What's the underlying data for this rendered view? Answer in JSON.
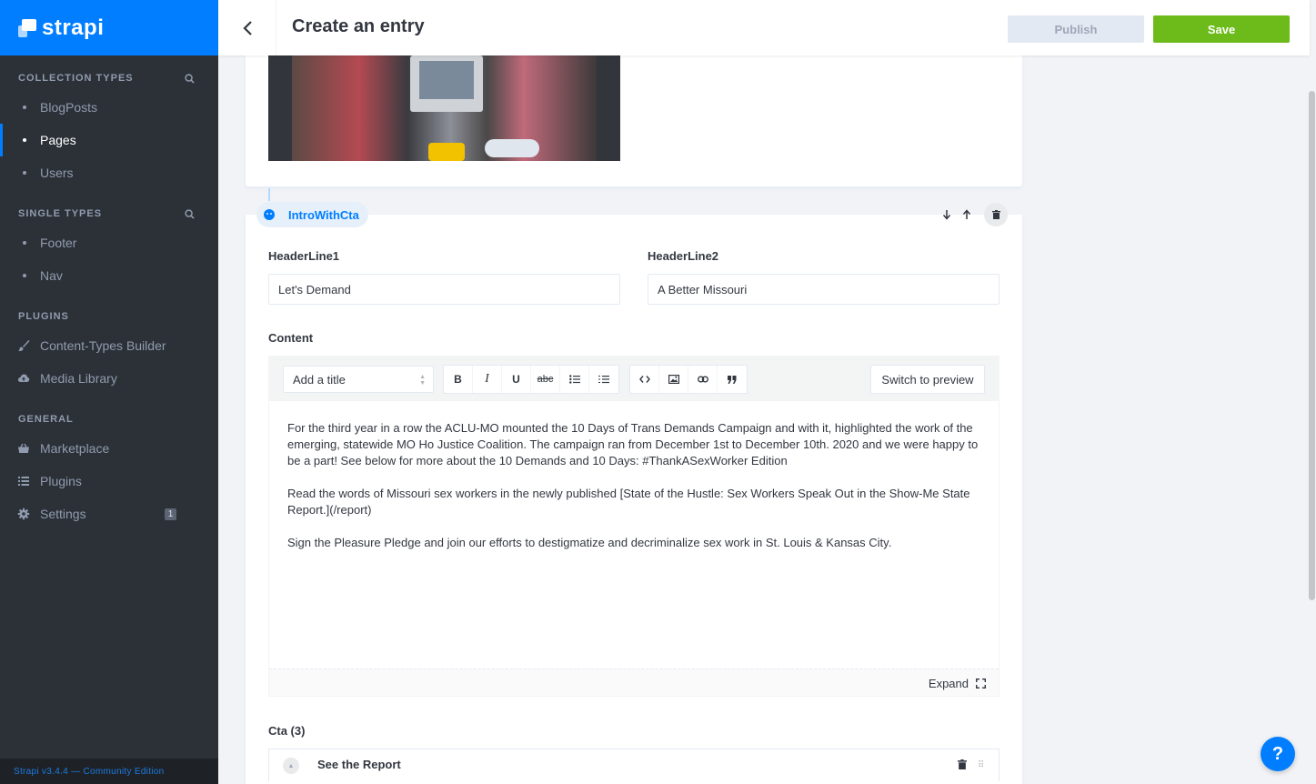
{
  "brand": {
    "name": "strapi"
  },
  "sidebar": {
    "collection_types": {
      "title": "COLLECTION TYPES",
      "items": [
        {
          "label": "BlogPosts"
        },
        {
          "label": "Pages"
        },
        {
          "label": "Users"
        }
      ]
    },
    "single_types": {
      "title": "SINGLE TYPES",
      "items": [
        {
          "label": "Footer"
        },
        {
          "label": "Nav"
        }
      ]
    },
    "plugins": {
      "title": "PLUGINS",
      "items": [
        {
          "label": "Content-Types Builder",
          "icon": "brush-icon"
        },
        {
          "label": "Media Library",
          "icon": "cloud-upload-icon"
        }
      ]
    },
    "general": {
      "title": "GENERAL",
      "items": [
        {
          "label": "Marketplace",
          "icon": "basket-icon"
        },
        {
          "label": "Plugins",
          "icon": "list-icon"
        },
        {
          "label": "Settings",
          "icon": "gear-icon",
          "badge": "1"
        }
      ]
    },
    "version": "Strapi v3.4.4 — Community Edition"
  },
  "header": {
    "title": "Create an entry",
    "publish_label": "Publish",
    "save_label": "Save"
  },
  "component": {
    "name": "IntroWithCta",
    "header_line1": {
      "label": "HeaderLine1",
      "value": "Let's Demand"
    },
    "header_line2": {
      "label": "HeaderLine2",
      "value": "A Better Missouri"
    },
    "content": {
      "label": "Content",
      "title_select": "Add a title",
      "tools": {
        "bold": "B",
        "italic": "I",
        "underline": "U",
        "strike": "abc"
      },
      "switch_label": "Switch to preview",
      "paragraphs": [
        "For the third year in a row the ACLU-MO mounted the 10 Days of Trans Demands Campaign and with it, highlighted the work of the emerging, statewide MO Ho Justice Coalition. The campaign ran from December 1st to December 10th. 2020 and we were happy to be a part! See below for more about the 10 Demands and 10 Days: #ThankASexWorker Edition",
        "Read the words of Missouri sex workers in the newly published [State of the Hustle: Sex Workers Speak Out in the Show-Me State Report.](/report)",
        "Sign the Pleasure Pledge and join our efforts to destigmatize and decriminalize sex work in St. Louis & Kansas City."
      ],
      "expand_label": "Expand"
    },
    "cta": {
      "label": "Cta (3)",
      "items": [
        {
          "label": "See the Report"
        }
      ]
    }
  },
  "help": {
    "label": "?"
  },
  "colors": {
    "accent": "#007eff",
    "save": "#6dbb1a",
    "sidebar": "#2c3138"
  }
}
